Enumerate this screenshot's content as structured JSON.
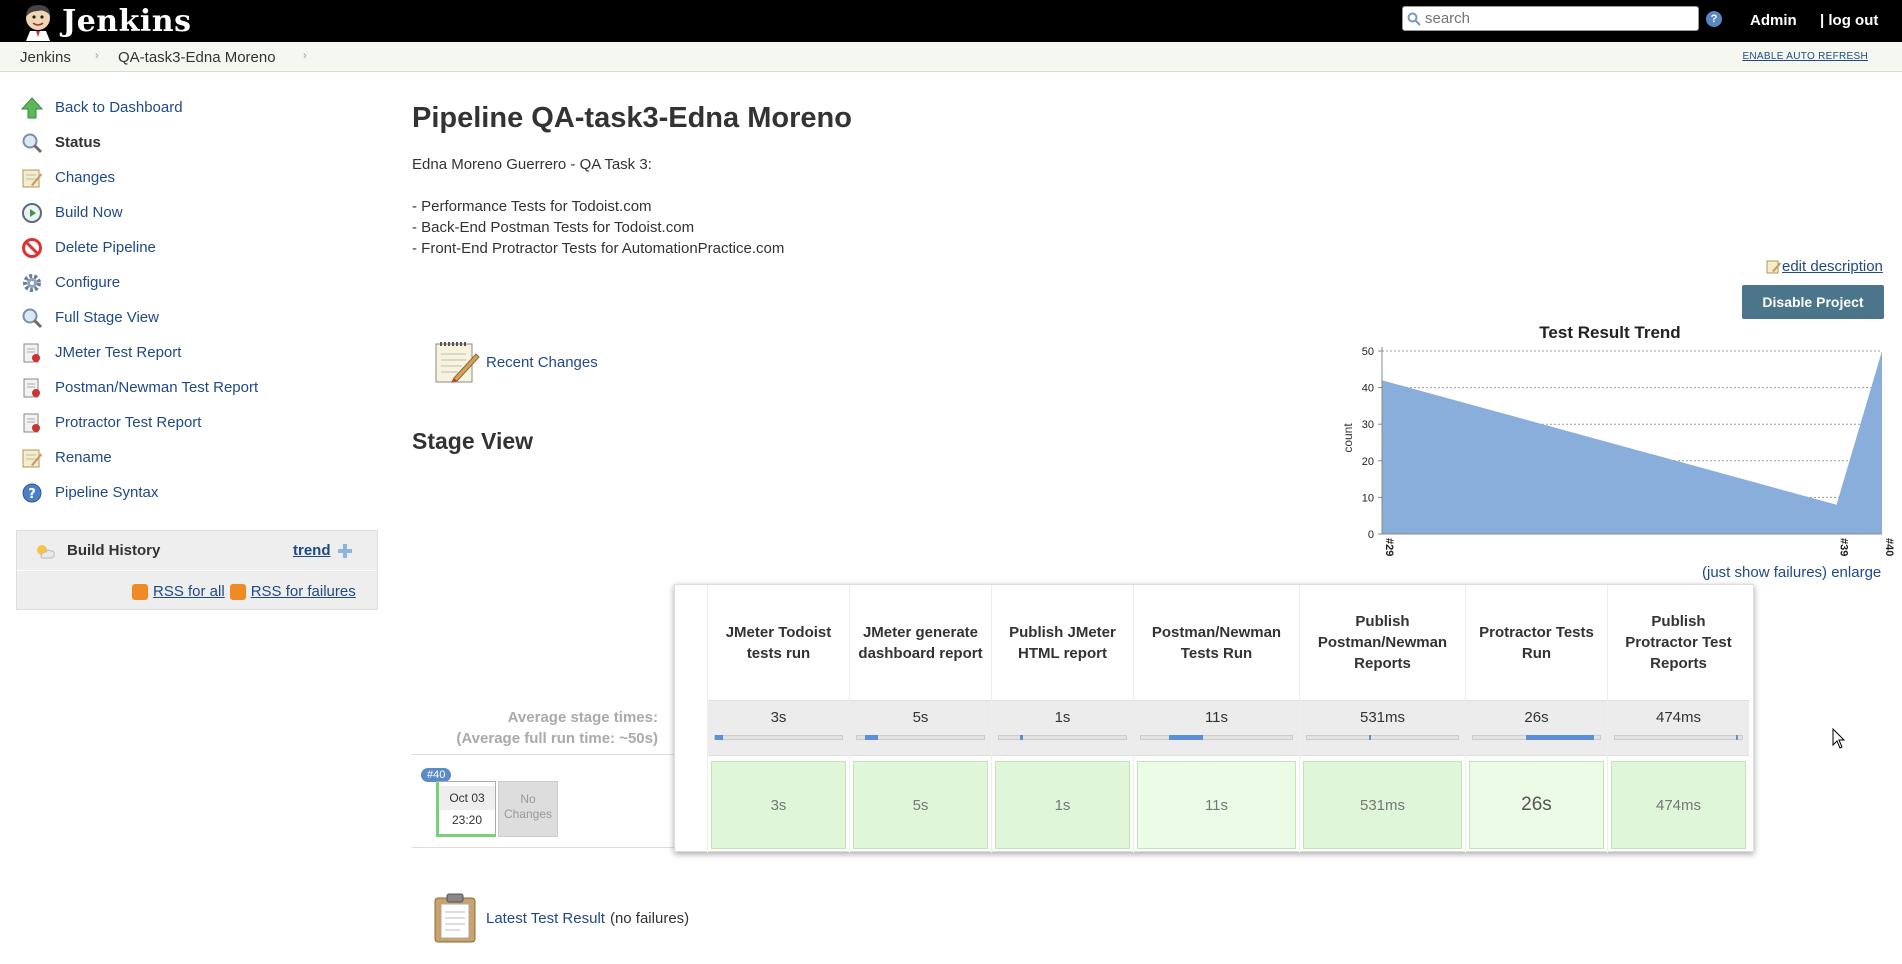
{
  "header": {
    "brand": "Jenkins",
    "search_placeholder": "search",
    "help": "?",
    "user": "Admin",
    "logout_prefix": "| ",
    "logout": "log out"
  },
  "breadcrumbs": {
    "items": [
      "Jenkins",
      "QA-task3-Edna Moreno"
    ],
    "auto_refresh": "ENABLE AUTO REFRESH"
  },
  "sidebar": {
    "items": [
      {
        "label": "Back to Dashboard",
        "icon": "up-arrow-icon"
      },
      {
        "label": "Status",
        "icon": "magnifier-icon"
      },
      {
        "label": "Changes",
        "icon": "notepad-icon"
      },
      {
        "label": "Build Now",
        "icon": "clock-play-icon"
      },
      {
        "label": "Delete Pipeline",
        "icon": "no-entry-icon"
      },
      {
        "label": "Configure",
        "icon": "gear-icon"
      },
      {
        "label": "Full Stage View",
        "icon": "magnifier-icon"
      },
      {
        "label": "JMeter Test Report",
        "icon": "report-icon"
      },
      {
        "label": "Postman/Newman Test Report",
        "icon": "report-icon"
      },
      {
        "label": "Protractor Test Report",
        "icon": "report-icon"
      },
      {
        "label": "Rename",
        "icon": "notepad-icon"
      },
      {
        "label": "Pipeline Syntax",
        "icon": "help-icon"
      }
    ]
  },
  "build_history": {
    "title": "Build History",
    "trend": "trend",
    "rss_all": "RSS for all",
    "rss_failures": "RSS for failures"
  },
  "main": {
    "title": "Pipeline QA-task3-Edna Moreno",
    "description": [
      "Edna Moreno Guerrero - QA Task 3:",
      "",
      "- Performance Tests for Todoist.com",
      "- Back-End Postman Tests for Todoist.com",
      "- Front-End Protractor Tests for AutomationPractice.com"
    ],
    "edit_description": "edit description",
    "disable_project": "Disable Project",
    "recent_changes": "Recent Changes",
    "stage_view_title": "Stage View",
    "latest_test_result": "Latest Test Result",
    "latest_test_suffix": "(no failures)"
  },
  "chart_links": {
    "just_show_failures": "(just show failures)",
    "enlarge": "enlarge"
  },
  "chart_data": {
    "type": "area",
    "title": "Test Result Trend",
    "xlabel": "",
    "ylabel": "count",
    "categories": [
      "#29",
      "#39",
      "#40"
    ],
    "series": [
      {
        "values": [
          42,
          8,
          50
        ]
      }
    ],
    "ylim": [
      0,
      50
    ],
    "yticks": [
      0,
      10,
      20,
      30,
      40,
      50
    ],
    "grid": true,
    "color": "#8aaedb"
  },
  "stage_view": {
    "avg_label_line1": "Average stage times:",
    "avg_label_line2": "(Average full run time: ~50s)",
    "stages": [
      {
        "name": "JMeter Todoist tests run",
        "avg": "3s",
        "cell": "3s",
        "progress": 0.06
      },
      {
        "name": "JMeter generate dashboard report",
        "avg": "5s",
        "cell": "5s",
        "progress": 0.1
      },
      {
        "name": "Publish JMeter HTML report",
        "avg": "1s",
        "cell": "1s",
        "progress": 0.02
      },
      {
        "name": "Postman/Newman Tests Run",
        "avg": "11s",
        "cell": "11s",
        "progress": 0.22
      },
      {
        "name": "Publish Postman/Newman Reports",
        "avg": "531ms",
        "cell": "531ms",
        "progress": 0.01
      },
      {
        "name": "Protractor Tests Run",
        "avg": "26s",
        "cell": "26s",
        "progress": 0.52
      },
      {
        "name": "Publish Protractor Test Reports",
        "avg": "474ms",
        "cell": "474ms",
        "progress": 0.01
      }
    ],
    "run": {
      "badge": "#40",
      "date": "Oct 03",
      "time": "23:20",
      "changes": "No Changes"
    }
  }
}
